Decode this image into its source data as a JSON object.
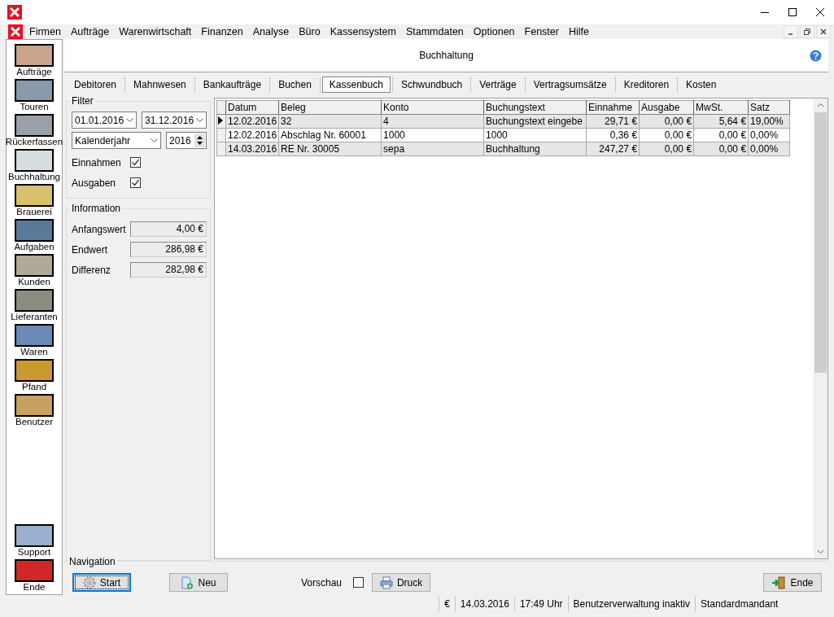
{
  "menu": [
    "Firmen",
    "Aufträge",
    "Warenwirtschaft",
    "Finanzen",
    "Analyse",
    "Büro",
    "Kassensystem",
    "Stammdaten",
    "Optionen",
    "Fenster",
    "Hilfe"
  ],
  "header": {
    "title": "Buchhaltung"
  },
  "sidebar": {
    "items": [
      {
        "label": "Aufträge"
      },
      {
        "label": "Touren"
      },
      {
        "label": "Rückerfassen"
      },
      {
        "label": "Buchhaltung"
      },
      {
        "label": "Brauerei"
      },
      {
        "label": "Aufgaben"
      },
      {
        "label": "Kunden"
      },
      {
        "label": "Lieferanten"
      },
      {
        "label": "Waren"
      },
      {
        "label": "Pfand"
      },
      {
        "label": "Benutzer"
      }
    ],
    "bottom_items": [
      {
        "label": "Support"
      },
      {
        "label": "Ende"
      }
    ]
  },
  "tabs": [
    {
      "label": "Debitoren",
      "selected": false
    },
    {
      "label": "Mahnwesen",
      "selected": false
    },
    {
      "label": "Bankaufträge",
      "selected": false
    },
    {
      "label": "Buchen",
      "selected": false
    },
    {
      "label": "Kassenbuch",
      "selected": true
    },
    {
      "label": "Schwundbuch",
      "selected": false
    },
    {
      "label": "Verträge",
      "selected": false
    },
    {
      "label": "Vertragsumsätze",
      "selected": false
    },
    {
      "label": "Kreditoren",
      "selected": false
    },
    {
      "label": "Kosten",
      "selected": false
    }
  ],
  "filter": {
    "title": "Filter",
    "date_from": "01.01.2016",
    "date_to": "31.12.2016",
    "period": "Kalenderjahr",
    "year": "2016",
    "checks": [
      {
        "label": "Einnahmen",
        "checked": true
      },
      {
        "label": "Ausgaben",
        "checked": true
      }
    ]
  },
  "information": {
    "title": "Information",
    "rows": [
      {
        "label": "Anfangswert",
        "value": "4,00 €"
      },
      {
        "label": "Endwert",
        "value": "286,98 €"
      },
      {
        "label": "Differenz",
        "value": "282,98 €"
      }
    ]
  },
  "table": {
    "columns": [
      {
        "label": "Datum",
        "kind": "text"
      },
      {
        "label": "Beleg",
        "kind": "text"
      },
      {
        "label": "Konto",
        "kind": "text"
      },
      {
        "label": "Buchungstext",
        "kind": "text"
      },
      {
        "label": "Einnahme",
        "kind": "amount"
      },
      {
        "label": "Ausgabe",
        "kind": "amount"
      },
      {
        "label": "MwSt.",
        "kind": "amount"
      },
      {
        "label": "Satz",
        "kind": "text"
      }
    ],
    "rows": [
      {
        "selected": true,
        "cells": [
          "12.02.2016",
          "32",
          "4",
          "Buchungstext eingebe",
          "29,71 €",
          "0,00 €",
          "5,64 €",
          "19,00%"
        ]
      },
      {
        "selected": false,
        "cells": [
          "12.02.2016",
          "Abschlag Nr. 60001",
          "1000",
          "1000",
          "0,36 €",
          "0,00 €",
          "0,00 €",
          "0,00%"
        ]
      },
      {
        "selected": false,
        "cells": [
          "14.03.2016",
          "RE Nr. 30005",
          "sepa",
          "Buchhaltung",
          "247,27 €",
          "0,00 €",
          "0,00 €",
          "0,00%"
        ]
      }
    ]
  },
  "navigation": {
    "title": "Navigation",
    "start": {
      "label": "Start",
      "focused": true
    },
    "new": {
      "label": "Neu",
      "focused": false
    },
    "preview": {
      "label": "Vorschau",
      "checked": false
    },
    "print": {
      "label": "Druck",
      "focused": false
    },
    "end": {
      "label": "Ende",
      "focused": false
    }
  },
  "status_bar": [
    "€",
    "14.03.2016",
    "17:49 Uhr",
    "Benutzerverwaltung inaktiv",
    "Standardmandant"
  ]
}
